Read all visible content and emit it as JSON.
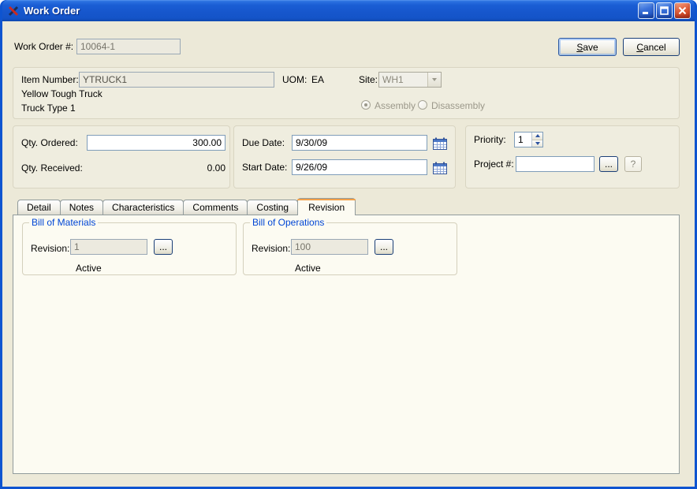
{
  "window": {
    "title": "Work Order"
  },
  "header": {
    "work_order_label": "Work Order #:",
    "work_order_value": "10064-1",
    "save_label": "Save",
    "cancel_label": "Cancel"
  },
  "item": {
    "item_number_label": "Item Number:",
    "item_number_value": "YTRUCK1",
    "uom_label": "UOM:",
    "uom_value": "EA",
    "site_label": "Site:",
    "site_value": "WH1",
    "description_line1": "Yellow Tough Truck",
    "description_line2": "Truck Type 1",
    "assembly_label": "Assembly",
    "disassembly_label": "Disassembly"
  },
  "qty": {
    "ordered_label": "Qty. Ordered:",
    "ordered_value": "300.00",
    "received_label": "Qty. Received:",
    "received_value": "0.00"
  },
  "dates": {
    "due_label": "Due Date:",
    "due_value": "9/30/09",
    "start_label": "Start Date:",
    "start_value": "9/26/09"
  },
  "priority": {
    "priority_label": "Priority:",
    "priority_value": "1",
    "project_label": "Project #:",
    "project_value": "",
    "ellipsis_label": "...",
    "help_label": "?"
  },
  "tabs": [
    {
      "label": "Detail"
    },
    {
      "label": "Notes"
    },
    {
      "label": "Characteristics"
    },
    {
      "label": "Comments"
    },
    {
      "label": "Costing"
    },
    {
      "label": "Revision"
    }
  ],
  "active_tab": "Revision",
  "revision_tab": {
    "bom": {
      "caption": "Bill of Materials",
      "revision_label": "Revision:",
      "revision_value": "1",
      "ellipsis_label": "...",
      "status": "Active"
    },
    "boo": {
      "caption": "Bill of Operations",
      "revision_label": "Revision:",
      "revision_value": "100",
      "ellipsis_label": "...",
      "status": "Active"
    }
  },
  "colors": {
    "titlebar_blue": "#1656CC",
    "close_red": "#CC3C18",
    "dialog_bg": "#ECE9D8",
    "groupbox_caption_blue": "#0046D5",
    "field_border": "#7F9DB9",
    "active_tab_highlight": "#EE8F28"
  }
}
